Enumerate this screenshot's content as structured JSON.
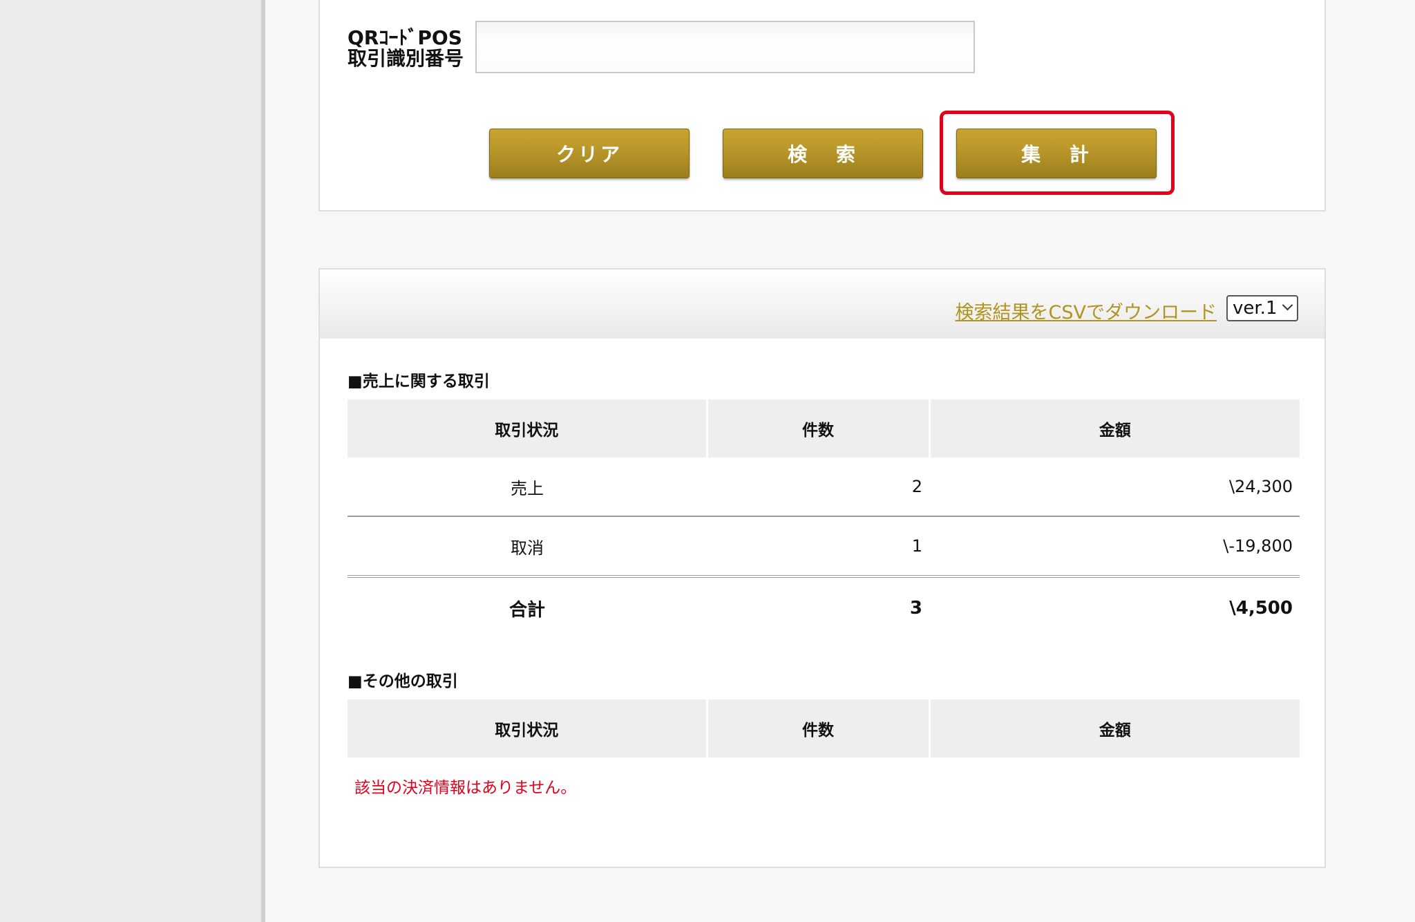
{
  "search": {
    "field_label_line1": "QRｺｰﾄﾞPOS",
    "field_label_line2": "取引識別番号",
    "field_value": "",
    "buttons": {
      "clear": "クリア",
      "search": "検 索",
      "total": "集 計"
    }
  },
  "results": {
    "csv_link": "検索結果をCSVでダウンロード",
    "version_selected": "ver.1",
    "sales_section": {
      "title": "■売上に関する取引",
      "headers": [
        "取引状況",
        "件数",
        "金額"
      ],
      "rows": [
        {
          "status": "売上",
          "count": "2",
          "amount": "\\24,300"
        },
        {
          "status": "取消",
          "count": "1",
          "amount": "\\-19,800"
        }
      ],
      "total": {
        "status": "合計",
        "count": "3",
        "amount": "\\4,500"
      }
    },
    "other_section": {
      "title": "■その他の取引",
      "headers": [
        "取引状況",
        "件数",
        "金額"
      ],
      "empty_message": "該当の決済情報はありません。"
    }
  },
  "colors": {
    "button_gold": "#b8962a",
    "link_gold": "#b09420",
    "highlight_red": "#e3001b",
    "sidebar_bg": "#ebebeb"
  }
}
